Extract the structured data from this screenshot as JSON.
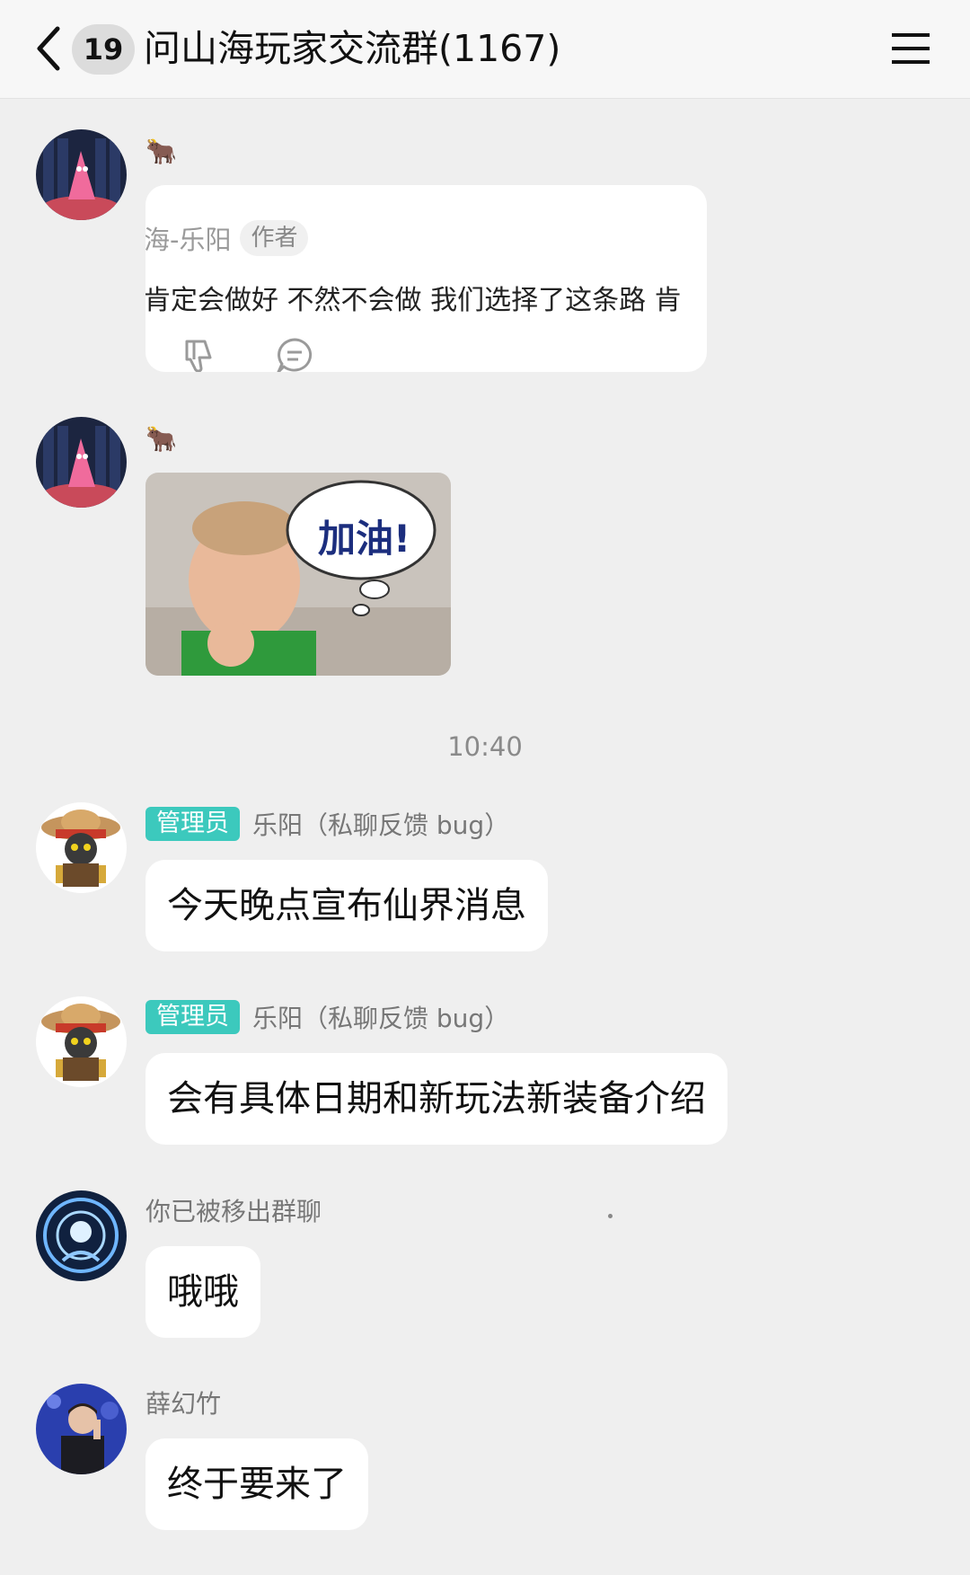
{
  "header": {
    "unread_count": "19",
    "title": "问山海玩家交流群(1167)"
  },
  "messages": [
    {
      "sender_emoji": "🐂",
      "quote": {
        "author": "海-乐阳",
        "author_tag": "作者",
        "text": "肯定会做好 不然不会做 我们选择了这条路 肯"
      }
    },
    {
      "sender_emoji": "🐂",
      "sticker_text": "加油!"
    },
    {
      "role_tag": "管理员",
      "sender": "乐阳（私聊反馈 bug）",
      "text": "今天晚点宣布仙界消息"
    },
    {
      "role_tag": "管理员",
      "sender": "乐阳（私聊反馈 bug）",
      "text": "会有具体日期和新玩法新装备介绍"
    },
    {
      "sender": "你已被移出群聊",
      "text": "哦哦"
    },
    {
      "sender": "薛幻竹",
      "text": "终于要来了"
    }
  ],
  "time_divider": "10:40",
  "colors": {
    "background": "#efefef",
    "bubble": "#ffffff",
    "admin_tag": "#3cc9bd",
    "header": "#f7f7f7"
  },
  "icons": {
    "back": "chevron-left-icon",
    "menu": "hamburger-menu-icon",
    "dislike": "thumbs-down-icon",
    "comment": "comment-bubble-icon"
  }
}
